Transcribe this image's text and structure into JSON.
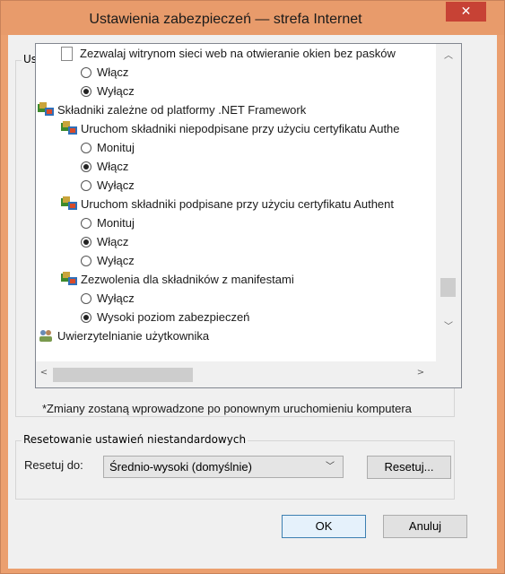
{
  "window": {
    "title": "Ustawienia zabezpieczeń — strefa Internet",
    "close": "✕"
  },
  "settings_group": {
    "label": "Ustawienia",
    "rows": [
      {
        "type": "item",
        "icon": "page-icon",
        "text": "Zezwalaj witrynom sieci web na otwieranie okien bez pasków"
      },
      {
        "type": "radio",
        "checked": false,
        "text": "Włącz"
      },
      {
        "type": "radio",
        "checked": true,
        "text": "Wyłącz"
      },
      {
        "type": "category",
        "icon": "net-icon",
        "text": "Składniki zależne od platformy .NET Framework"
      },
      {
        "type": "item",
        "icon": "net-icon",
        "text": "Uruchom składniki niepodpisane przy użyciu certyfikatu Authe"
      },
      {
        "type": "radio",
        "checked": false,
        "text": "Monituj"
      },
      {
        "type": "radio",
        "checked": true,
        "text": "Włącz"
      },
      {
        "type": "radio",
        "checked": false,
        "text": "Wyłącz"
      },
      {
        "type": "item",
        "icon": "net-icon",
        "text": "Uruchom składniki podpisane przy użyciu certyfikatu Authent"
      },
      {
        "type": "radio",
        "checked": false,
        "text": "Monituj"
      },
      {
        "type": "radio",
        "checked": true,
        "text": "Włącz"
      },
      {
        "type": "radio",
        "checked": false,
        "text": "Wyłącz"
      },
      {
        "type": "item",
        "icon": "net-icon",
        "text": "Zezwolenia dla składników z manifestami"
      },
      {
        "type": "radio",
        "checked": false,
        "text": "Wyłącz"
      },
      {
        "type": "radio",
        "checked": true,
        "text": "Wysoki poziom zabezpieczeń"
      },
      {
        "type": "category",
        "icon": "users-icon",
        "text": "Uwierzytelnianie użytkownika"
      }
    ],
    "note": "*Zmiany zostaną wprowadzone po ponownym uruchomieniu komputera"
  },
  "reset_group": {
    "label": "Resetowanie ustawień niestandardowych",
    "reset_to_label": "Resetuj do:",
    "selected": "Średnio-wysoki (domyślnie)",
    "reset_button": "Resetuj..."
  },
  "footer": {
    "ok": "OK",
    "cancel": "Anuluj"
  }
}
